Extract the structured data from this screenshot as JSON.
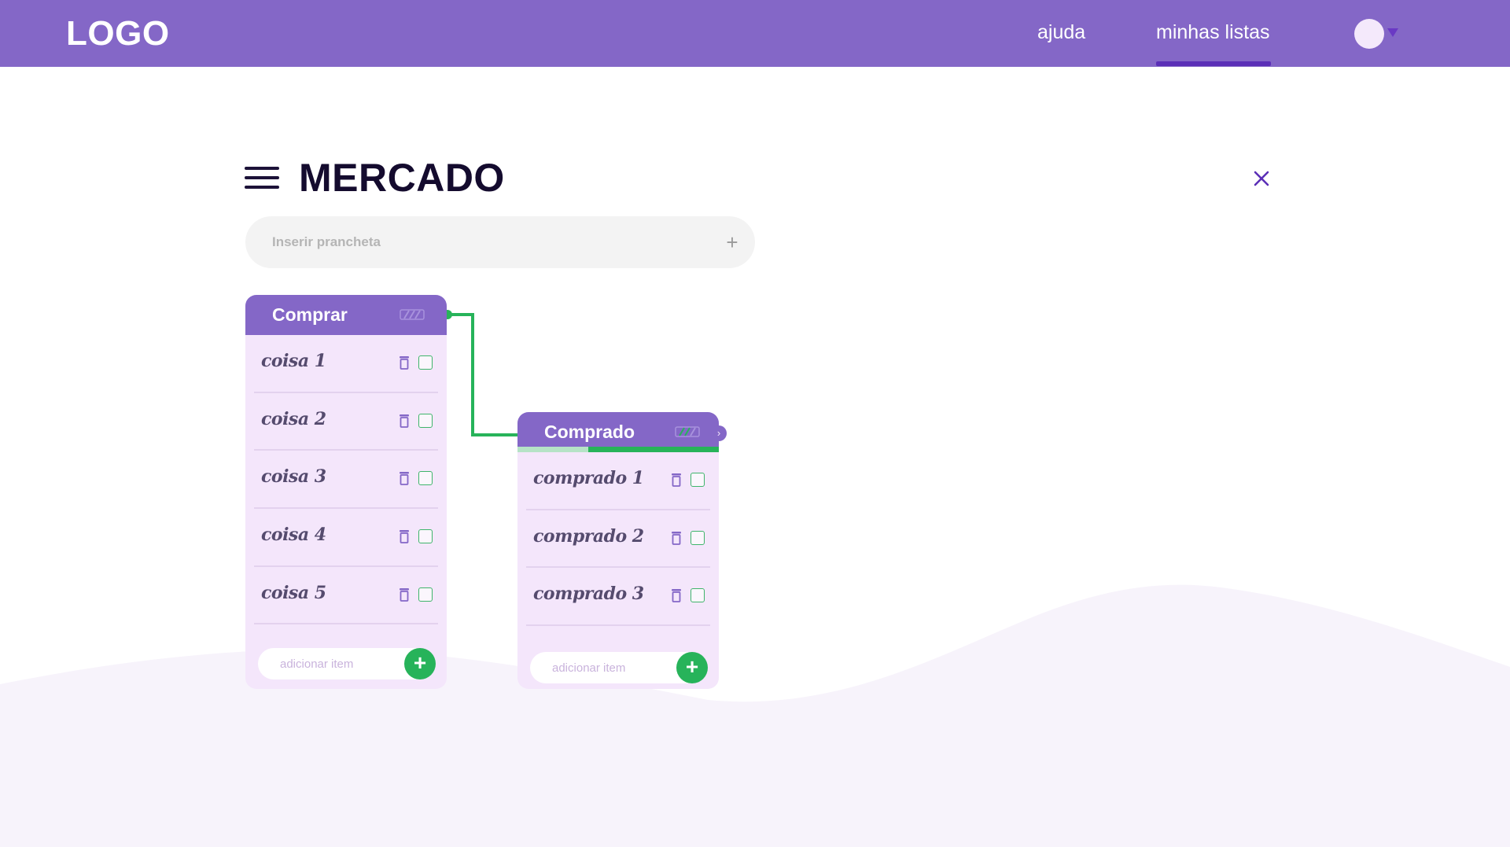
{
  "header": {
    "logo": "LOGO",
    "nav": [
      {
        "label": "ajuda",
        "active": false
      },
      {
        "label": "minhas listas",
        "active": true
      }
    ],
    "avatar_icon": "user-avatar-icon"
  },
  "board": {
    "title": "MERCADO",
    "insert": {
      "placeholder": "Inserir prancheta",
      "value": "",
      "add_symbol": "+"
    }
  },
  "lists": [
    {
      "title": "Comprar",
      "progress": 0,
      "items": [
        "coisa 1",
        "coisa 2",
        "coisa 3",
        "coisa 4",
        "coisa 5"
      ],
      "add_placeholder": "adicionar item"
    },
    {
      "title": "Comprado",
      "progress": 0.65,
      "next_symbol": "›",
      "items": [
        "comprado 1",
        "comprado 2",
        "comprado 3"
      ],
      "add_placeholder": "adicionar item"
    }
  ],
  "add_symbol": "+",
  "colors": {
    "brand": "#8467c7",
    "nav_active": "#5b2fb7",
    "accent_green": "#27b35a",
    "card_bg": "#f4e6fb",
    "title": "#140b2e"
  }
}
